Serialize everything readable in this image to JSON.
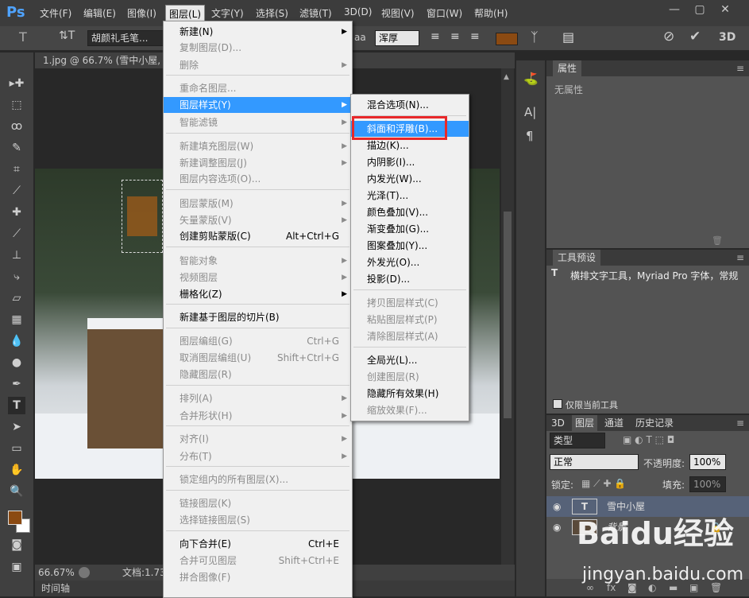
{
  "app": {
    "logo": "Ps"
  },
  "menubar": {
    "items": [
      "文件(F)",
      "编辑(E)",
      "图像(I)",
      "图层(L)",
      "文字(Y)",
      "选择(S)",
      "滤镜(T)",
      "3D(D)",
      "视图(V)",
      "窗口(W)",
      "帮助(H)"
    ],
    "active_index": 3,
    "window_buttons": [
      "—",
      "▢",
      "✕"
    ]
  },
  "options_bar": {
    "font_family": "胡颜礼毛笔...",
    "font_size_label": "aa",
    "antialias": "浑厚",
    "color": "#8b4a12"
  },
  "document": {
    "tab_title": "1.jpg @ 66.7% (雪中小屋, R...",
    "zoom": "66.67%",
    "doc_info": "文档:1.73"
  },
  "timeline": {
    "label": "时间轴"
  },
  "layer_menu": {
    "items": [
      {
        "label": "新建(N)",
        "shortcut": "",
        "submenu": true,
        "disabled": false
      },
      {
        "label": "复制图层(D)...",
        "shortcut": "",
        "submenu": false,
        "disabled": true
      },
      {
        "label": "删除",
        "shortcut": "",
        "submenu": true,
        "disabled": true
      },
      {
        "label": "重命名图层...",
        "shortcut": "",
        "submenu": false,
        "disabled": true
      },
      {
        "label": "图层样式(Y)",
        "shortcut": "",
        "submenu": true,
        "disabled": false
      },
      {
        "label": "智能滤镜",
        "shortcut": "",
        "submenu": true,
        "disabled": true
      },
      {
        "label": "新建填充图层(W)",
        "shortcut": "",
        "submenu": true,
        "disabled": true
      },
      {
        "label": "新建调整图层(J)",
        "shortcut": "",
        "submenu": true,
        "disabled": true
      },
      {
        "label": "图层内容选项(O)...",
        "shortcut": "",
        "submenu": false,
        "disabled": true
      },
      {
        "label": "图层蒙版(M)",
        "shortcut": "",
        "submenu": true,
        "disabled": true
      },
      {
        "label": "矢量蒙版(V)",
        "shortcut": "",
        "submenu": true,
        "disabled": true
      },
      {
        "label": "创建剪贴蒙版(C)",
        "shortcut": "Alt+Ctrl+G",
        "submenu": false,
        "disabled": false
      },
      {
        "label": "智能对象",
        "shortcut": "",
        "submenu": true,
        "disabled": true
      },
      {
        "label": "视频图层",
        "shortcut": "",
        "submenu": true,
        "disabled": true
      },
      {
        "label": "栅格化(Z)",
        "shortcut": "",
        "submenu": true,
        "disabled": false
      },
      {
        "label": "新建基于图层的切片(B)",
        "shortcut": "",
        "submenu": false,
        "disabled": false
      },
      {
        "label": "图层编组(G)",
        "shortcut": "Ctrl+G",
        "submenu": false,
        "disabled": true
      },
      {
        "label": "取消图层编组(U)",
        "shortcut": "Shift+Ctrl+G",
        "submenu": false,
        "disabled": true
      },
      {
        "label": "隐藏图层(R)",
        "shortcut": "",
        "submenu": false,
        "disabled": true
      },
      {
        "label": "排列(A)",
        "shortcut": "",
        "submenu": true,
        "disabled": true
      },
      {
        "label": "合并形状(H)",
        "shortcut": "",
        "submenu": true,
        "disabled": true
      },
      {
        "label": "对齐(I)",
        "shortcut": "",
        "submenu": true,
        "disabled": true
      },
      {
        "label": "分布(T)",
        "shortcut": "",
        "submenu": true,
        "disabled": true
      },
      {
        "label": "锁定组内的所有图层(X)...",
        "shortcut": "",
        "submenu": false,
        "disabled": true
      },
      {
        "label": "链接图层(K)",
        "shortcut": "",
        "submenu": false,
        "disabled": true
      },
      {
        "label": "选择链接图层(S)",
        "shortcut": "",
        "submenu": false,
        "disabled": true
      },
      {
        "label": "向下合并(E)",
        "shortcut": "Ctrl+E",
        "submenu": false,
        "disabled": false
      },
      {
        "label": "合并可见图层",
        "shortcut": "Shift+Ctrl+E",
        "submenu": false,
        "disabled": true
      },
      {
        "label": "拼合图像(F)",
        "shortcut": "",
        "submenu": false,
        "disabled": true
      }
    ],
    "highlighted_index": 4
  },
  "style_submenu": {
    "items": [
      {
        "label": "混合选项(N)...",
        "disabled": false
      },
      {
        "label": "斜面和浮雕(B)...",
        "disabled": false
      },
      {
        "label": "描边(K)...",
        "disabled": false
      },
      {
        "label": "内阴影(I)...",
        "disabled": false
      },
      {
        "label": "内发光(W)...",
        "disabled": false
      },
      {
        "label": "光泽(T)...",
        "disabled": false
      },
      {
        "label": "颜色叠加(V)...",
        "disabled": false
      },
      {
        "label": "渐变叠加(G)...",
        "disabled": false
      },
      {
        "label": "图案叠加(Y)...",
        "disabled": false
      },
      {
        "label": "外发光(O)...",
        "disabled": false
      },
      {
        "label": "投影(D)...",
        "disabled": false
      },
      {
        "label": "拷贝图层样式(C)",
        "disabled": true
      },
      {
        "label": "粘贴图层样式(P)",
        "disabled": true
      },
      {
        "label": "清除图层样式(A)",
        "disabled": true
      },
      {
        "label": "全局光(L)...",
        "disabled": false
      },
      {
        "label": "创建图层(R)",
        "disabled": true
      },
      {
        "label": "隐藏所有效果(H)",
        "disabled": false
      },
      {
        "label": "缩放效果(F)...",
        "disabled": true
      }
    ],
    "highlighted_index": 1
  },
  "properties_panel": {
    "title": "属性",
    "empty_text": "无属性"
  },
  "tool_presets_panel": {
    "title": "工具预设",
    "preset_text": "横排文字工具，Myriad Pro 字体，常规",
    "only_current_tool_label": "仅限当前工具"
  },
  "layers_panel": {
    "tabs": [
      "3D",
      "图层",
      "通道",
      "历史记录"
    ],
    "active_tab": 1,
    "filter_kind": "类型",
    "blend_mode": "正常",
    "opacity_label": "不透明度:",
    "opacity_value": "100%",
    "lock_label": "锁定:",
    "fill_label": "填充:",
    "fill_value": "100%",
    "layers": [
      {
        "name": "雪中小屋",
        "type": "text",
        "selected": true
      },
      {
        "name": "背景",
        "type": "image",
        "selected": false
      }
    ]
  },
  "watermark": {
    "text": "Baidu经验",
    "sub": "jingyan.baidu.com"
  },
  "colors": {
    "foreground": "#8b4a12",
    "background": "#ffffff",
    "menu_highlight": "#3399ff",
    "callout": "#e8282a"
  }
}
